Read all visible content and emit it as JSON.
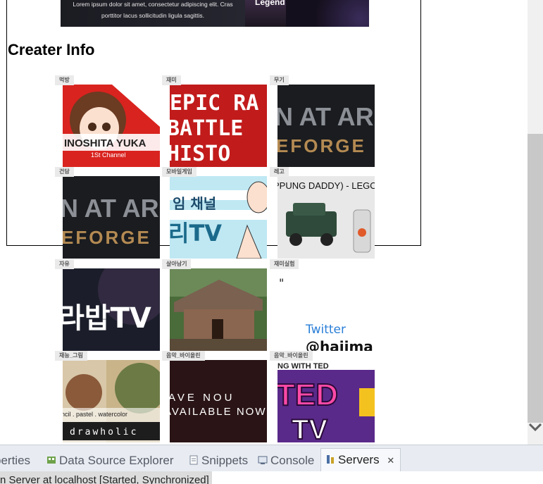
{
  "banner": {
    "text": "Lorem ipsum dolor sit amet, consectetur adipiscing elit. Cras\nporttitor lacus sollicitudin ligula sagittis.",
    "legend": "Legend"
  },
  "heading": "Creater Info",
  "cards": [
    {
      "tag": "먹방",
      "art": "anime",
      "text": "INOSHITA YUKA",
      "sub": "1St Channel"
    },
    {
      "tag": "재미",
      "art": "epic",
      "text": "EPIC RAP BATTLES HISTORY"
    },
    {
      "tag": "무기",
      "art": "forge",
      "text": "N AT AR EFORGE"
    },
    {
      "tag": "건담",
      "art": "forge",
      "text": "N AT AR EFORGE"
    },
    {
      "tag": "모바일게임",
      "art": "cartoon",
      "text": "리TV",
      "sub": "임 채널"
    },
    {
      "tag": "레고",
      "art": "lego",
      "text": "PPUNG DADDY) - LEGO"
    },
    {
      "tag": "자유",
      "art": "neon",
      "text": "라밥TV"
    },
    {
      "tag": "살아남기",
      "art": "hut",
      "text": ""
    },
    {
      "tag": "재미실험",
      "art": "twitter",
      "text": "Twitter",
      "sub": "@hajima"
    },
    {
      "tag": "재능_그림",
      "art": "draw",
      "text": "drawholic",
      "sub": "ncil . pastel . watercolor"
    },
    {
      "tag": "음악_바이올린",
      "art": "music",
      "text": "AVAILABLE NOW",
      "sub": "AVE NOU"
    },
    {
      "tag": "음악_바이올린",
      "art": "ted",
      "text": "TED TV",
      "sub": "NG WITH TED"
    }
  ],
  "ide": {
    "tabs": [
      {
        "label": "perties",
        "icon": "properties-icon"
      },
      {
        "label": "Data Source Explorer",
        "icon": "data-source-icon"
      },
      {
        "label": "Snippets",
        "icon": "snippets-icon"
      },
      {
        "label": "Console",
        "icon": "console-icon"
      },
      {
        "label": "Servers",
        "icon": "servers-icon",
        "active": true
      }
    ],
    "status": "n Server at localhost  [Started, Synchronized]"
  },
  "colors": {
    "ide_background": "#e8ecf2",
    "tag_background": "#eaeaea",
    "scroll_thumb": "#c8c8c8"
  }
}
